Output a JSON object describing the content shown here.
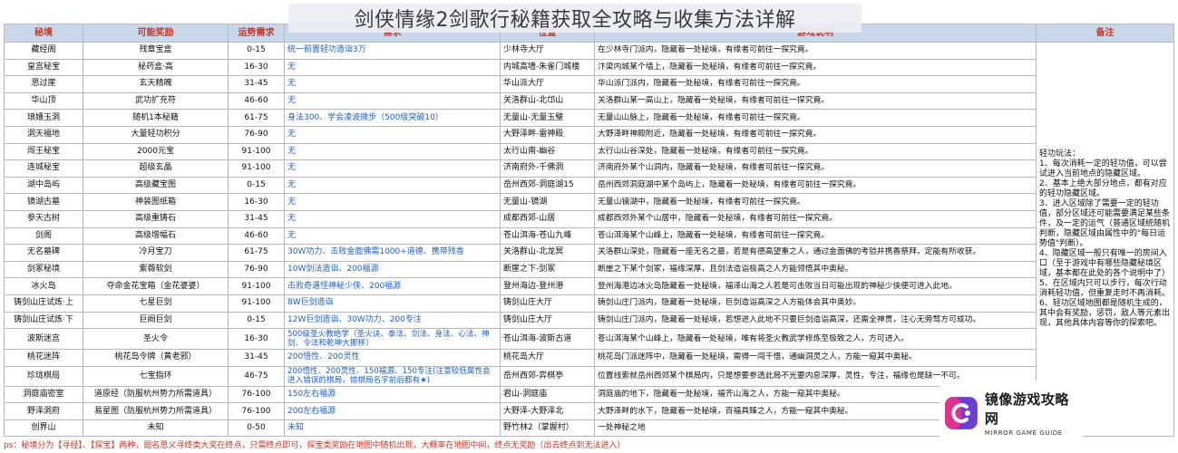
{
  "title": "剑侠情缘2剑歌行秘籍获取全攻略与收集方法详解",
  "headers": {
    "realm": "秘境",
    "reward": "可能奖励",
    "req": "运势需求",
    "cond": "需求",
    "loc": "位置",
    "how": "游戏说明",
    "note": "备注"
  },
  "rows": [
    {
      "realm": "藏经阁",
      "reward": "残章宝盒",
      "req": "0-15",
      "cond": "统一前置轻功造诣3万",
      "loc": "少林寺大厅",
      "how": "在少林寺门派内，隐藏着一处秘境，有缘者可前往一探究竟。"
    },
    {
      "realm": "皇宫秘宝",
      "reward": "秘药盒·高",
      "req": "16-30",
      "cond": "无",
      "loc": "内城高墙-朱雀门城楼",
      "how": "汴梁内城某个墙上，隐藏着一处秘境，有缘者可前往一探究竟。"
    },
    {
      "realm": "思过崖",
      "reward": "玄天精魄",
      "req": "31-45",
      "cond": "无",
      "loc": "华山派大厅",
      "how": "华山派门派内，隐藏着一处秘境，有缘者可前往一探究竟。"
    },
    {
      "realm": "华山顶",
      "reward": "武功扩充符",
      "req": "46-60",
      "cond": "无",
      "loc": "关洛群山-北邙山",
      "how": "关洛群山某一高山上，隐藏着一处秘境，有缘者可前往一探究竟。"
    },
    {
      "realm": "琅嬛玉洞",
      "reward": "随机1本秘籍",
      "req": "61-75",
      "cond": "身法300、学会凌波微步（500级突破10）",
      "loc": "无量山-无量玉璧",
      "how": "无量山山脉上，隐藏着一处秘境，有缘者可前往一探究竟。"
    },
    {
      "realm": "洞天福地",
      "reward": "大量轻功积分",
      "req": "76-90",
      "cond": "无",
      "loc": "大野泽畔-雷神殿",
      "how": "大野泽畔神殿附近，隐藏着一处秘境，有缘者可前往一探究竟。"
    },
    {
      "realm": "闯王秘宝",
      "reward": "2000元宝",
      "req": "91-100",
      "cond": "无",
      "loc": "太行山南-幽谷",
      "how": "太行山山谷深处，隐藏着一处秘境，有缘者可前往一探究竟。"
    },
    {
      "realm": "连城秘宝",
      "reward": "超级玄晶",
      "req": "91-100",
      "cond": "无",
      "loc": "济南府外-千佛洞",
      "how": "济南府外某个山洞内，隐藏着一处秘境，有缘者可前往一探究竟。"
    },
    {
      "realm": "湖中岛屿",
      "reward": "高级藏宝图",
      "req": "0-15",
      "cond": "无",
      "loc": "岳州西郊-洞庭湖15",
      "how": "岳州西郊洞庭湖中某个岛屿上，隐藏着一处秘境，有缘者可前往一探究竟。"
    },
    {
      "realm": "镜湖古墓",
      "reward": "神装图纸箱",
      "req": "16-30",
      "cond": "无",
      "loc": "无量山-镜湖",
      "how": "无量山镜湖中，隐藏着一处秘境，有缘者可前往一探究竟。"
    },
    {
      "realm": "参天古树",
      "reward": "高级重铸石",
      "req": "31-45",
      "cond": "无",
      "loc": "成都西郊-山居",
      "how": "成都西郊外某个山居中，隐藏着一处秘境，有缘者可前往一探究竟。"
    },
    {
      "realm": "剑阁",
      "reward": "高级增幅石",
      "req": "46-60",
      "cond": "无",
      "loc": "苍山洱海-苍山九峰",
      "how": "苍山洱海某个山峰上，隐藏着一处秘境，有缘者可前往一探究竟。"
    },
    {
      "realm": "无名墓碑",
      "reward": "冷月宝刀",
      "req": "61-75",
      "cond": "30W功力、击败金面佛需1000+道德、携带残香",
      "loc": "关洛群山-北龙冥",
      "how": "关洛群山深处，隐藏着一座无名之墓，若是有德高望重之人，通过金面佛的考验并携香祭拜，定能有所收获。"
    },
    {
      "realm": "剑冢秘境",
      "reward": "紫薇软剑",
      "req": "76-90",
      "cond": "10W剑法造诣、200福源",
      "loc": "断崖之下-剑冢",
      "how": "断崖之下某个剑冢，福缘深厚，且剑法造诣极高之人方能领悟其中奥秘。"
    },
    {
      "realm": "冰火岛",
      "reward": "夺命金花宝箱（金花婆婆）",
      "req": "91-100",
      "cond": "击败奇遇怪神秘少侠、200福源",
      "loc": "登州海边-登州港",
      "how": "登州海港边冰火岛隐藏着一处秘境，福泽山海之人若是可击败当日可能出现的神秘少侠便可进入此地。"
    },
    {
      "realm": "铸剑山庄试炼·上",
      "reward": "七星巨剑",
      "req": "91-100",
      "cond": "8W巨剑造诣",
      "loc": "铸剑山庄大厅",
      "how": "铸剑山庄门派内，隐藏着一处秘境，巨剑造诣高深之人方能体会其中奥妙。"
    },
    {
      "realm": "铸剑山庄试炼·下",
      "reward": "巨阙巨剑",
      "req": "0-15",
      "cond": "12W巨剑造诣、30W功力、200专注",
      "loc": "铸剑山庄大厅",
      "how": "铸剑山庄门派内，隐藏着一处秘境，若想进入此地不只要巨剑造诣高深，还需全神贯，注心无旁骛方可成功。"
    },
    {
      "realm": "波斯迷宫",
      "reward": "圣火令",
      "req": "16-30",
      "cond": "500级圣火教绝学（圣火诀、拳法、剑法、身法、心法、神剑、令法和乾坤大挪移）",
      "loc": "苍山洱海-波斯古道",
      "how": "苍山洱海某个山峰上，隐藏着一处秘境，唯有将圣火教武学修炼至极致之人，方可进入。"
    },
    {
      "realm": "桃花迷阵",
      "reward": "桃花岛令牌（黄老邪）",
      "req": "31-45",
      "cond": "200悟性、200灵性",
      "loc": "桃花岛大厅",
      "how": "桃花岛门派迷阵中，隐藏着一处秘境，需得一闯千悟，通幽洞灵之人，方能一窥其中奥秘。"
    },
    {
      "realm": "珍珑棋局",
      "reward": "七宝指环",
      "req": "46-75",
      "cond": "200悟性、200灵性、150福源、150专注(注意较低属性会进入错误的棋局，错棋局名字前后都有★)",
      "loc": "岳州西郊-弈棋亭",
      "how": "位置线索就岳州西郊某个棋局内，只是想要参透此局不光要内息深厚，灵性，专注，福缘也是缺一不可。"
    },
    {
      "realm": "洞庭庙密室",
      "reward": "道原经（防服杭州势力所需道具）",
      "req": "76-100",
      "cond": "150左右福源",
      "loc": "君山-洞庭庙",
      "how": "洞庭庙的地下，隐藏着一处秘境，福齐山海之人，方能一窥其中奥秘。"
    },
    {
      "realm": "野泽洞府",
      "reward": "易星图（防服杭州势力所需道具）",
      "req": "76-100",
      "cond": "200左右福源",
      "loc": "大野泽-大野泽北",
      "how": "大野泽畔的水下，隐藏着一处秘境，百福具臻之人，方能一窥其中奥秘。"
    },
    {
      "realm": "创界山",
      "reward": "未知",
      "req": "0-50",
      "cond": "未知",
      "loc": "野竹林2（掌握村）",
      "how": "一处神秘之地"
    }
  ],
  "note": "轻功玩法：\n1、每次消耗一定的轻功值，可以尝试进入当前地点的隐藏区域。\n2、基本上绝大部分地点，都有对应的轻功隐藏区域。\n3、进入区域除了需要一定的轻功值，部分区域还可能需要满足某些条件，及一定的运气（普通区域统随机判断，隐藏区域由属性中的\"每日运势值\"判断）。\n4、隐藏区域一般只有唯一的房间入口（至于游戏中有哪些隐藏秘境区域，基本都在此处的各个说明中了）\n5、在区域内只可以步行，每次行动消耗轻功值，但重复走时不再消耗。\n6、轻功区域地图都是随机生成的，其中会有奖励，惩罚，敌人等元素出现，其他具体内容等你的探索吧。",
  "footnote": "ps：秘境分为【寻经】、【探宝】两种，题名思义寻终类大奖在终点，只需终点即可，探宝类奖励在地图中随机出现，大概率在地图中间，终点无奖励（出去终点到无法进入）",
  "watermark": {
    "cn": "镜像游戏攻略网",
    "en": "MIRROR GAME GUIDE"
  },
  "colors": {
    "header_bg": "#c9d7ea",
    "header_text": "#c0392b",
    "requirement_text": "#1f5fbf",
    "footnote_text": "#c0392b"
  }
}
